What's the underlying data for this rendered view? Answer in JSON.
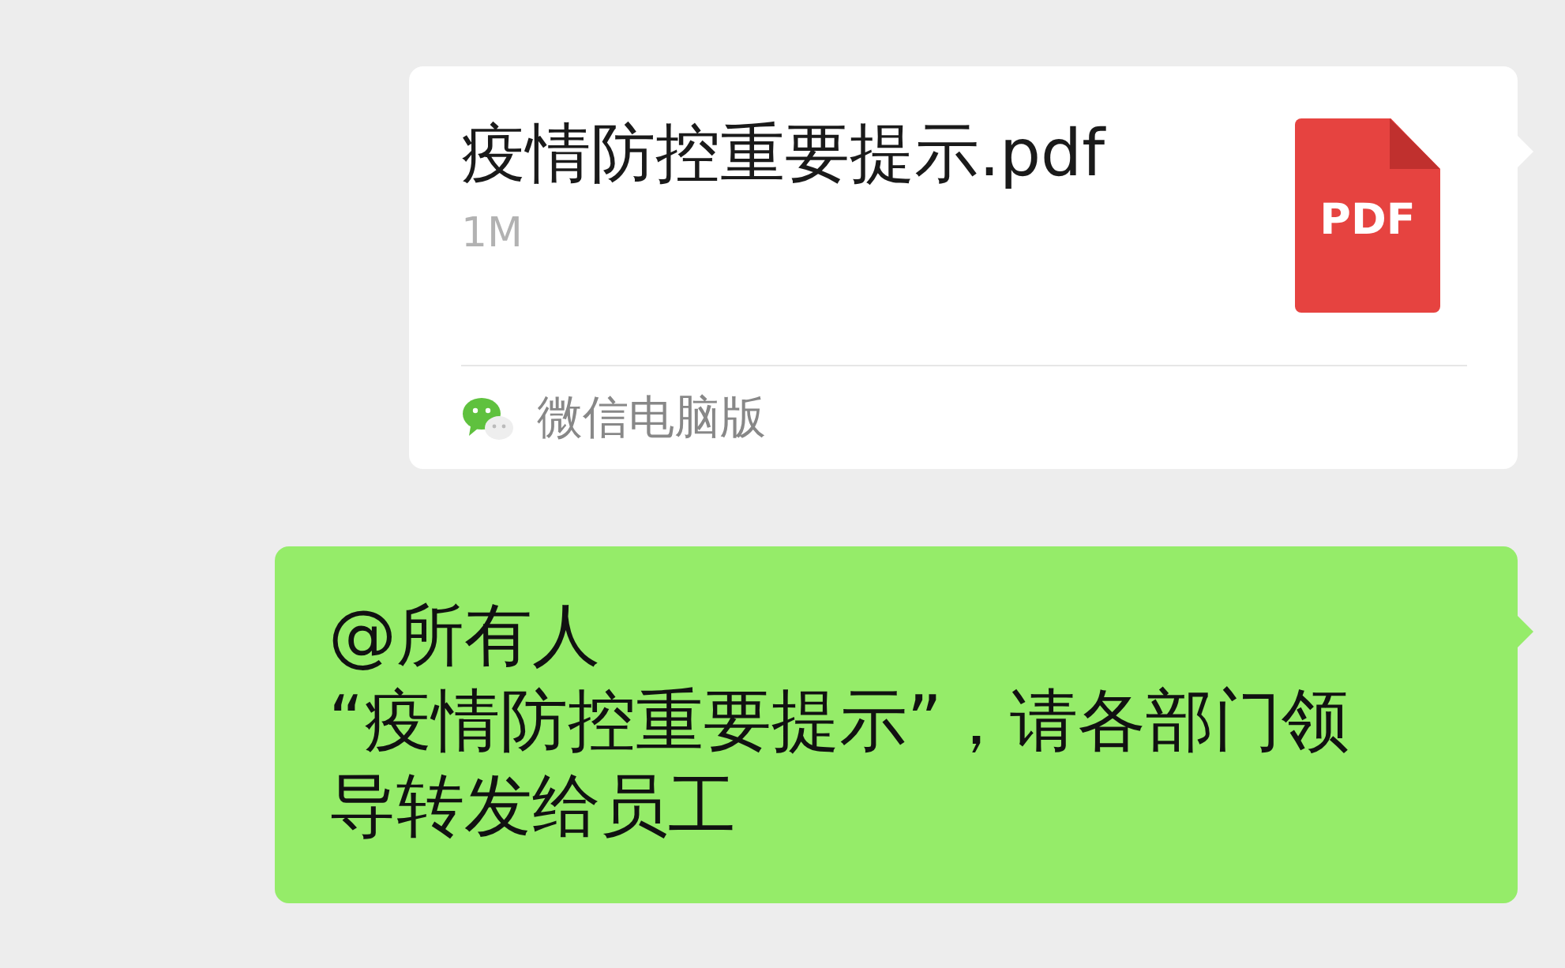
{
  "file_message": {
    "file_name": "疫情防控重要提示.pdf",
    "file_size": "1M",
    "file_type": "PDF",
    "source": "微信电脑版"
  },
  "text_message": {
    "mention": "@所有人",
    "text": "“疫情防控重要提示”，请各部门领导转发给员工"
  }
}
